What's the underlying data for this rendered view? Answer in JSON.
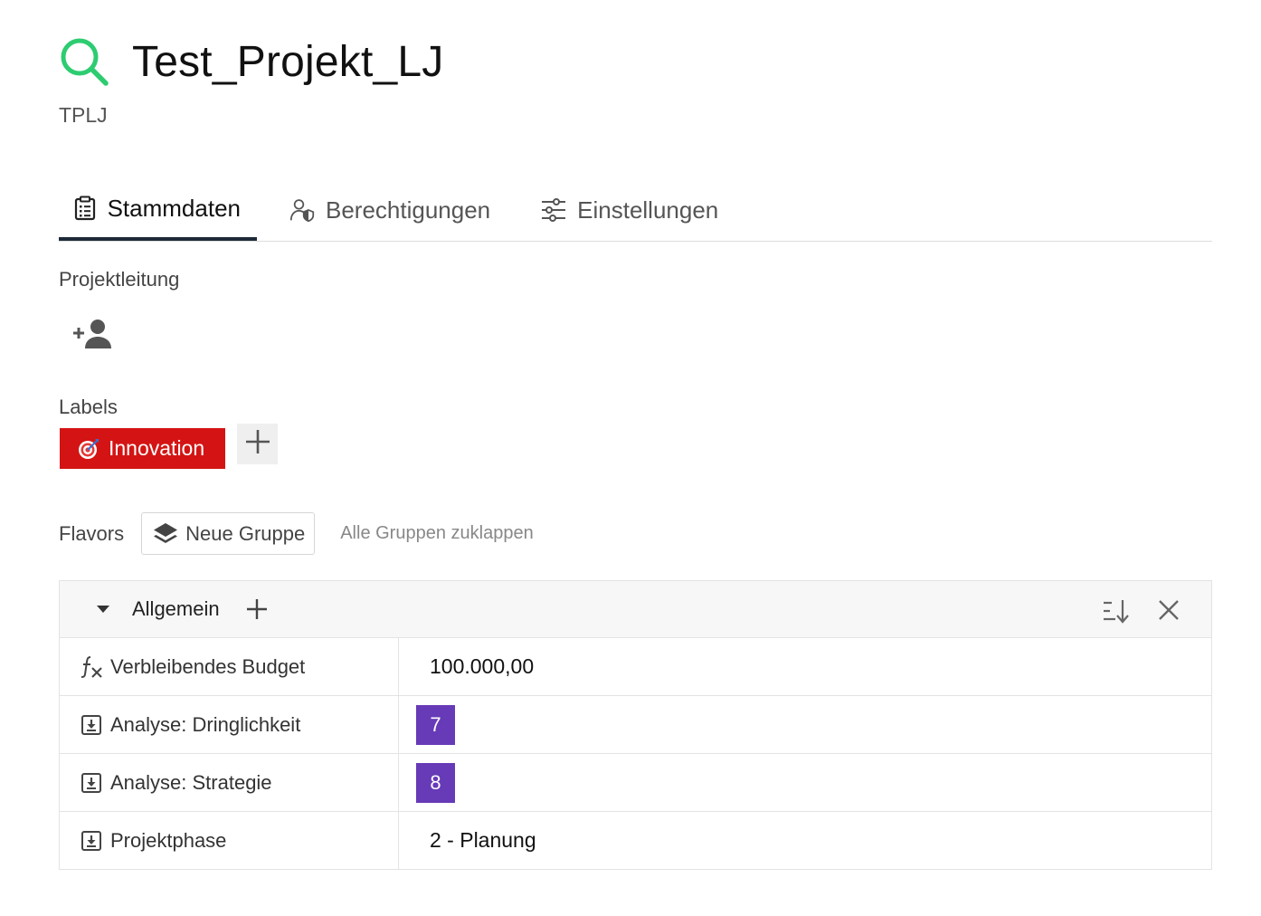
{
  "header": {
    "title": "Test_Projekt_LJ",
    "subtitle": "TPLJ",
    "logo_icon": "search-icon",
    "logo_color": "#2ecc71"
  },
  "tabs": [
    {
      "label": "Stammdaten",
      "icon": "clipboard-icon",
      "active": true
    },
    {
      "label": "Berechtigungen",
      "icon": "user-shield-icon",
      "active": false
    },
    {
      "label": "Einstellungen",
      "icon": "sliders-icon",
      "active": false
    }
  ],
  "projektleitung": {
    "label": "Projektleitung",
    "add_icon": "add-person-icon"
  },
  "labels": {
    "label": "Labels",
    "items": [
      {
        "text": "Innovation",
        "icon": "target-icon",
        "color": "#d41414"
      }
    ],
    "add_icon": "plus-icon"
  },
  "flavors": {
    "label": "Flavors",
    "new_group_label": "Neue Gruppe",
    "collapse_all_label": "Alle Gruppen zuklappen"
  },
  "group": {
    "name": "Allgemein",
    "rows": [
      {
        "key": "Verbleibendes Budget",
        "icon": "function-icon",
        "value": "100.000,00",
        "badge": false
      },
      {
        "key": "Analyse: Dringlichkeit",
        "icon": "import-icon",
        "value": "7",
        "badge": true
      },
      {
        "key": "Analyse: Strategie",
        "icon": "import-icon",
        "value": "8",
        "badge": true
      },
      {
        "key": "Projektphase",
        "icon": "import-icon",
        "value": "2 - Planung",
        "badge": false
      }
    ],
    "badge_color": "#673ab7"
  }
}
